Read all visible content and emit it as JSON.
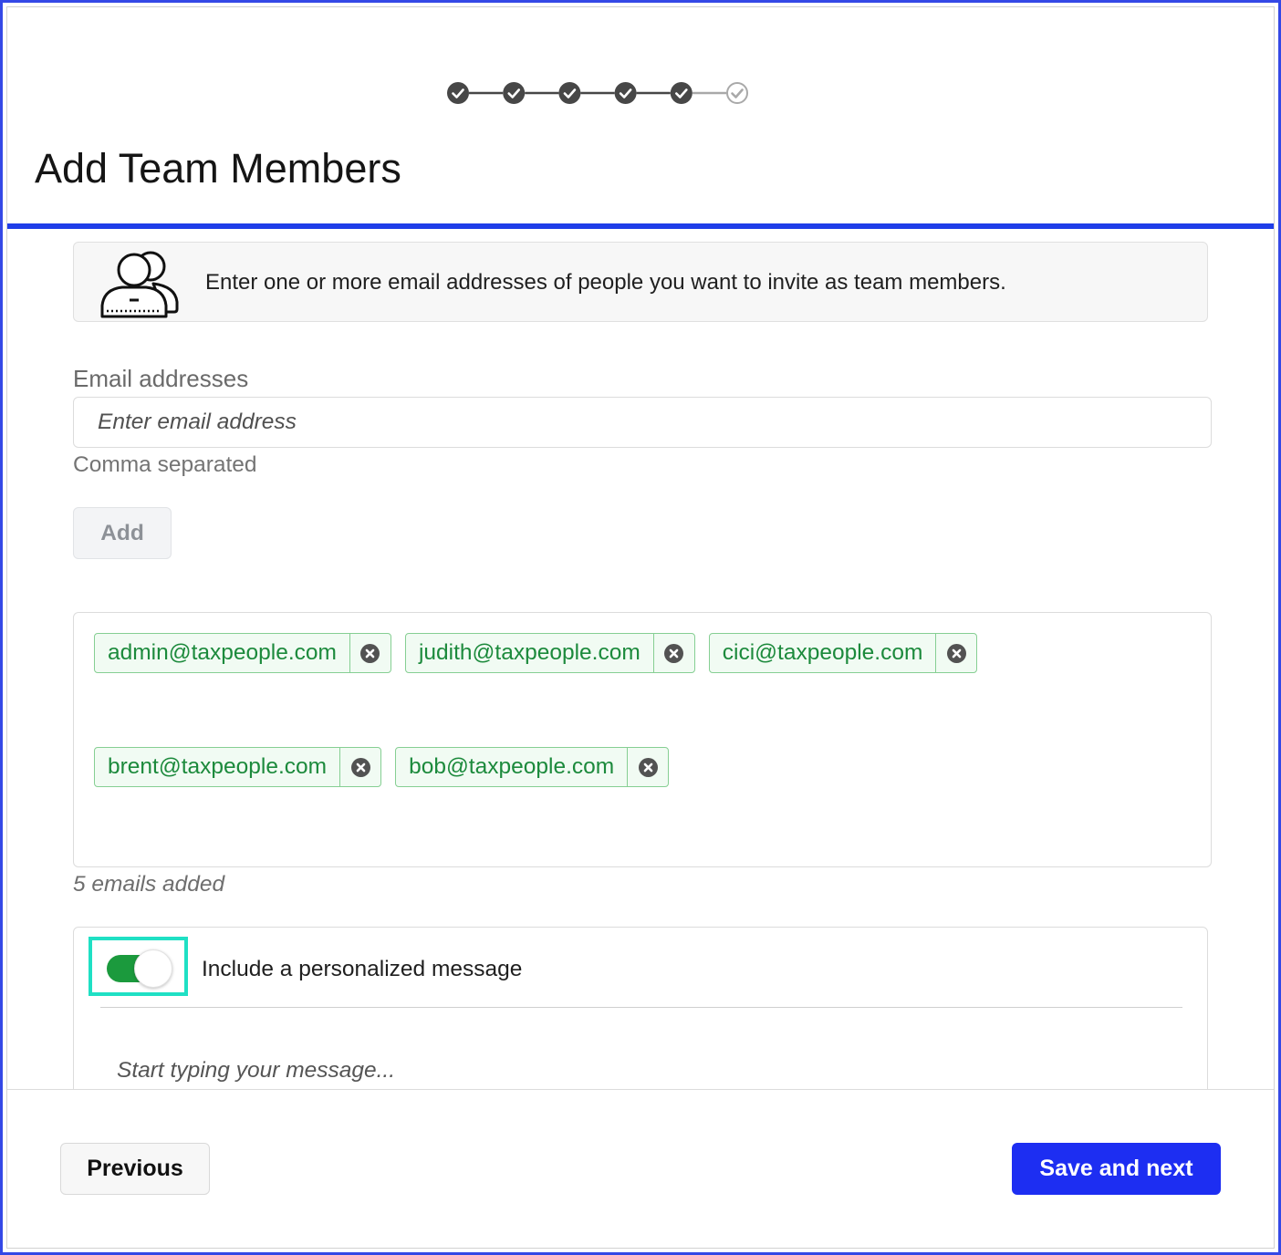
{
  "stepper": {
    "steps": [
      {
        "status": "complete",
        "icon": "check-circle-icon"
      },
      {
        "status": "complete",
        "icon": "check-circle-icon"
      },
      {
        "status": "complete",
        "icon": "check-circle-icon"
      },
      {
        "status": "complete",
        "icon": "check-circle-icon"
      },
      {
        "status": "complete",
        "icon": "check-circle-icon"
      },
      {
        "status": "incomplete",
        "icon": "check-circle-outline-icon"
      }
    ]
  },
  "page_title": "Add Team Members",
  "info": {
    "icon": "team-members-icon",
    "text": "Enter one or more email addresses of people you want to invite as team members."
  },
  "email_field": {
    "label": "Email addresses",
    "value": "",
    "placeholder": "Enter email address",
    "hint": "Comma separated"
  },
  "add_button": {
    "label": "Add",
    "disabled": true
  },
  "emails": [
    {
      "address": "admin@taxpeople.com"
    },
    {
      "address": "judith@taxpeople.com"
    },
    {
      "address": "cici@taxpeople.com"
    },
    {
      "address": "brent@taxpeople.com"
    },
    {
      "address": "bob@taxpeople.com"
    }
  ],
  "email_remove_icon": "close-circle-icon",
  "emails_count_text": "5 emails added",
  "message": {
    "toggle_label": "Include a personalized message",
    "toggle_on": true,
    "value": "",
    "placeholder": "Start typing your message..."
  },
  "footer": {
    "previous_label": "Previous",
    "next_label": "Save and next"
  },
  "colors": {
    "primary": "#1d2ef2",
    "success": "#1b9a3d",
    "chip_text": "#1c8a3c",
    "highlight": "#1fe0c4",
    "step_complete": "#474747"
  }
}
